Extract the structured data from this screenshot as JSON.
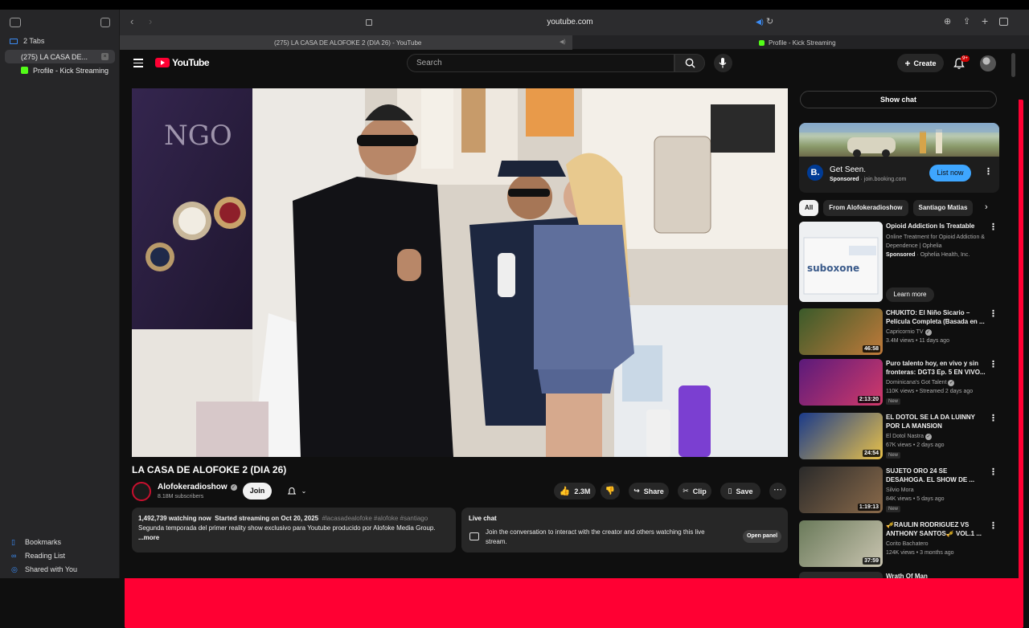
{
  "browser": {
    "url": "youtube.com",
    "sidebar": {
      "tab_group": "2 Tabs",
      "tabs": [
        {
          "label": "(275) LA CASA DE...",
          "active": true
        },
        {
          "label": "Profile - Kick Streaming",
          "active": false
        }
      ],
      "bottom": [
        "Bookmarks",
        "Reading List",
        "Shared with You"
      ]
    },
    "tabbar": [
      {
        "label": "(275) LA CASA DE ALOFOKE 2 (DIA 26) - YouTube"
      },
      {
        "label": "Profile - Kick Streaming"
      }
    ]
  },
  "youtube": {
    "logo": "YouTube",
    "search_placeholder": "Search",
    "create_label": "Create",
    "notif_badge": "9+",
    "video": {
      "title": "LA CASA DE ALOFOKE 2 (DIA 26)",
      "channel": "Alofokeradioshow",
      "subscribers": "8.18M subscribers",
      "join": "Join",
      "likes": "2.3M",
      "share": "Share",
      "clip": "Clip",
      "save": "Save",
      "watching": "1,492,739 watching now",
      "started": "Started streaming on Oct 20, 2025",
      "hashtags": "#lacasadealofoke #alofoke #santiago",
      "description": "Segunda temporada del primer reality show exclusivo para Youtube producido por Alofoke Media Group.",
      "more": "...more"
    },
    "livechat": {
      "title": "Live chat",
      "text": "Join the conversation to interact with the creator and others watching this live stream.",
      "button": "Open panel"
    },
    "show_chat": "Show chat",
    "ad": {
      "title": "Get Seen.",
      "sponsored": "Sponsored",
      "domain": "· join.booking.com",
      "cta": "List now",
      "logo": "B."
    },
    "chips": [
      "All",
      "From Alofokeradioshow",
      "Santiago Matias"
    ],
    "recommendations": [
      {
        "title": "Opioid Addiction Is Treatable",
        "line1": "Online Treatment for Opioid Addiction & Dependence | Ophelia",
        "sponsored": "Sponsored",
        "advertiser": "· Ophelia Health, Inc.",
        "cta": "Learn more"
      },
      {
        "title": "CHUKITO: El Niño Sicario – Película Completa (Basada en ...",
        "channel": "Capricornio TV",
        "meta": "3.4M views • 11 days ago",
        "duration": "46:58"
      },
      {
        "title": "Puro talento hoy, en vivo y sin fronteras: DGT3 Ep. 5 EN VIVO...",
        "channel": "Dominicana's Got Talent",
        "meta": "110K views • Streamed 2 days ago",
        "duration": "2:13:20",
        "badge": "New"
      },
      {
        "title": "EL DOTOL SE LA DA LUINNY POR LA MANSION",
        "channel": "El Dotol Nastra",
        "meta": "67K views • 2 days ago",
        "duration": "24:54",
        "badge": "New"
      },
      {
        "title": "SUJETO ORO 24 SE DESAHOGA. EL SHOW DE ...",
        "channel": "Silvio Mora",
        "meta": "84K views • 5 days ago",
        "duration": "1:19:13",
        "badge": "New"
      },
      {
        "title": "🎺RAULIN RODRIGUEZ VS ANTHONY SANTOS🎺 VOL.1 ...",
        "channel": "Corito Bachatero",
        "meta": "124K views • 3 months ago",
        "duration": "37:59"
      },
      {
        "title": "Wrath Of Man"
      }
    ]
  }
}
